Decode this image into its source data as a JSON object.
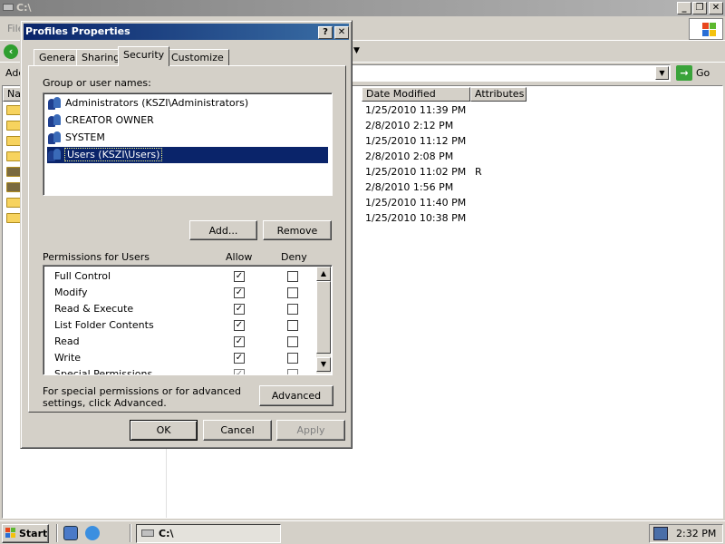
{
  "explorer": {
    "title": "C:\\",
    "menu_partial": "File",
    "address_label_partial": "Add",
    "go_label": "Go",
    "go_icon": "go-arrow-icon",
    "columns": {
      "name_partial": "Na",
      "date_modified": "Date Modified",
      "attributes": "Attributes"
    },
    "rows": [
      {
        "date": "1/25/2010 11:39 PM",
        "attr": ""
      },
      {
        "date": "2/8/2010 2:12 PM",
        "attr": ""
      },
      {
        "date": "1/25/2010 11:12 PM",
        "attr": ""
      },
      {
        "date": "2/8/2010 2:08 PM",
        "attr": ""
      },
      {
        "date": "1/25/2010 11:02 PM",
        "attr": "R"
      },
      {
        "date": "2/8/2010 1:56 PM",
        "attr": ""
      },
      {
        "date": "1/25/2010 11:40 PM",
        "attr": ""
      },
      {
        "date": "1/25/2010 10:38 PM",
        "attr": ""
      }
    ]
  },
  "dialog": {
    "title": "Profiles Properties",
    "help_label": "?",
    "close_label": "✕",
    "tabs": [
      {
        "label": "General"
      },
      {
        "label": "Sharing"
      },
      {
        "label": "Security"
      },
      {
        "label": "Customize"
      }
    ],
    "group_label": "Group or user names:",
    "users": [
      {
        "name": "Administrators (KSZI\\Administrators)"
      },
      {
        "name": "CREATOR OWNER"
      },
      {
        "name": "SYSTEM"
      },
      {
        "name": "Users (KSZI\\Users)"
      }
    ],
    "selected_user_index": 3,
    "add_button": "Add...",
    "remove_button": "Remove",
    "permissions_label": "Permissions for Users",
    "allow_label": "Allow",
    "deny_label": "Deny",
    "permissions": [
      {
        "name": "Full Control",
        "allow": true,
        "deny": false
      },
      {
        "name": "Modify",
        "allow": true,
        "deny": false
      },
      {
        "name": "Read & Execute",
        "allow": true,
        "deny": false
      },
      {
        "name": "List Folder Contents",
        "allow": true,
        "deny": false
      },
      {
        "name": "Read",
        "allow": true,
        "deny": false
      },
      {
        "name": "Write",
        "allow": true,
        "deny": false
      },
      {
        "name": "Special Permissions",
        "allow": true,
        "deny": false
      }
    ],
    "special_text": "For special permissions or for advanced settings, click Advanced.",
    "advanced_button": "Advanced",
    "ok_button": "OK",
    "cancel_button": "Cancel",
    "apply_button": "Apply"
  },
  "taskbar": {
    "start_label": "Start",
    "task_item": "C:\\",
    "clock": "2:32 PM"
  }
}
